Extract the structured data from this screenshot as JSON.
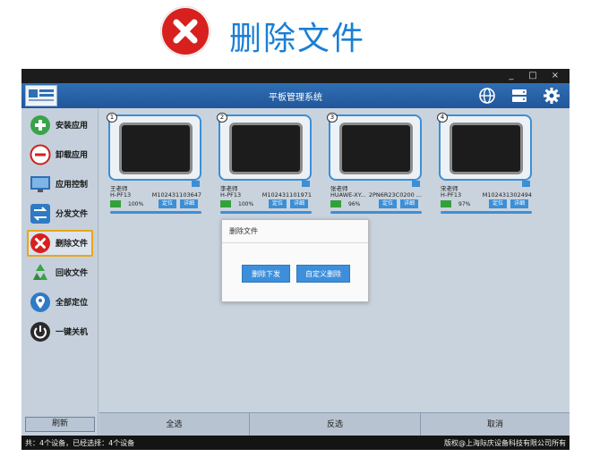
{
  "caption": {
    "icon": "red-x-circle-icon",
    "text": "删除文件",
    "text_color": "#1a7fd6",
    "icon_color": "#d8201e"
  },
  "window": {
    "controls": [
      "_",
      "□",
      "×"
    ]
  },
  "titlebar": {
    "title": "平板管理系统",
    "icons": [
      "globe-icon",
      "server-icon",
      "gear-icon"
    ]
  },
  "sidebar": {
    "items": [
      {
        "label": "安装应用",
        "icon": "install-plus-icon",
        "active": false
      },
      {
        "label": "卸载应用",
        "icon": "uninstall-minus-icon",
        "active": false
      },
      {
        "label": "应用控制",
        "icon": "app-control-monitor-icon",
        "active": false
      },
      {
        "label": "分发文件",
        "icon": "distribute-arrows-icon",
        "active": false
      },
      {
        "label": "删除文件",
        "icon": "delete-x-icon",
        "active": true
      },
      {
        "label": "回收文件",
        "icon": "recycle-icon",
        "active": false
      },
      {
        "label": "全部定位",
        "icon": "location-pin-icon",
        "active": false
      },
      {
        "label": "一键关机",
        "icon": "power-icon",
        "active": false
      }
    ],
    "refresh_label": "刷新"
  },
  "devices": [
    {
      "num": "1",
      "name": "王老师",
      "model": "H-PF13",
      "serial": "M102431103647",
      "battery": "100%",
      "locate": "定位",
      "detail": "详细"
    },
    {
      "num": "2",
      "name": "李老师",
      "model": "H-PF13",
      "serial": "M102431101971",
      "battery": "100%",
      "locate": "定位",
      "detail": "详细"
    },
    {
      "num": "3",
      "name": "张老师",
      "model": "HUAWE-XY...",
      "serial": "2PN6R23C0200 ...",
      "battery": "96%",
      "locate": "定位",
      "detail": "详细"
    },
    {
      "num": "4",
      "name": "宋老师",
      "model": "H-PF13",
      "serial": "M102431302494",
      "battery": "97%",
      "locate": "定位",
      "detail": "详细"
    }
  ],
  "dialog": {
    "title": "删除文件",
    "button_delete_send": "删除下发",
    "button_custom_delete": "自定义删除"
  },
  "actions": {
    "select_all": "全选",
    "invert": "反选",
    "cancel": "取消"
  },
  "status": {
    "left": "共：4个设备，已经选择：4个设备",
    "right": "版权@上海际庆设备科技有限公司所有"
  },
  "colors": {
    "accent": "#3c8fd6",
    "titlebar": "#21569a",
    "active_border": "#e8a617"
  }
}
